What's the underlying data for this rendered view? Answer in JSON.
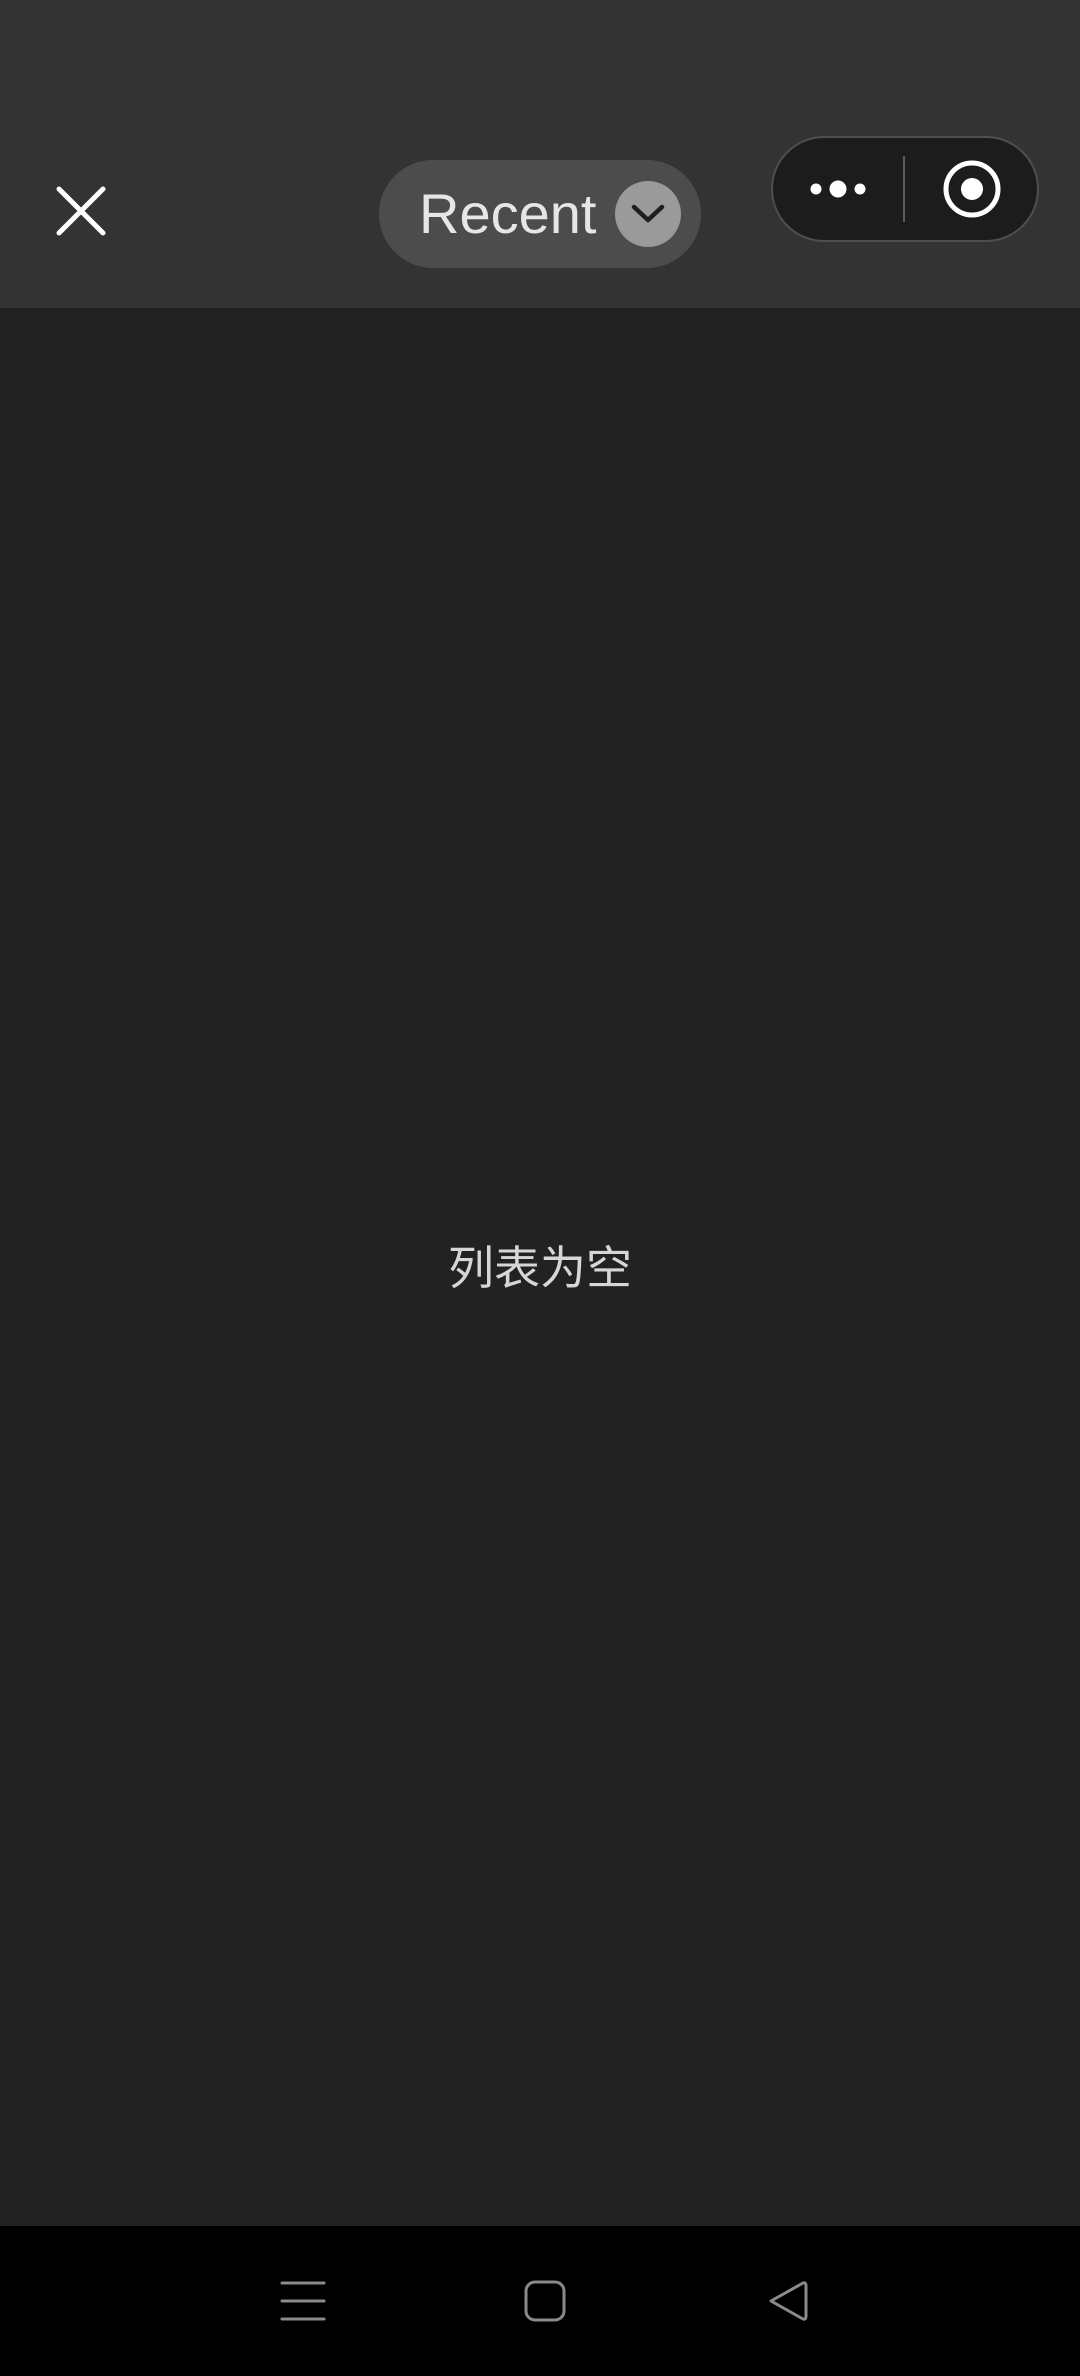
{
  "header": {
    "album_picker": {
      "label": "Recent"
    }
  },
  "content": {
    "empty_message": "列表为空"
  },
  "icons": {
    "close": "close-icon",
    "chevron": "chevron-down-icon",
    "more": "more-dots-icon",
    "record": "record-target-icon",
    "nav_menu": "menu-lines-icon",
    "nav_home": "home-square-icon",
    "nav_back": "back-triangle-icon"
  },
  "colors": {
    "header_bg": "#333333",
    "content_bg": "#222222",
    "nav_bg": "#000000",
    "picker_bg": "#4c4c4c",
    "chevron_bg": "#9a9a9a"
  }
}
